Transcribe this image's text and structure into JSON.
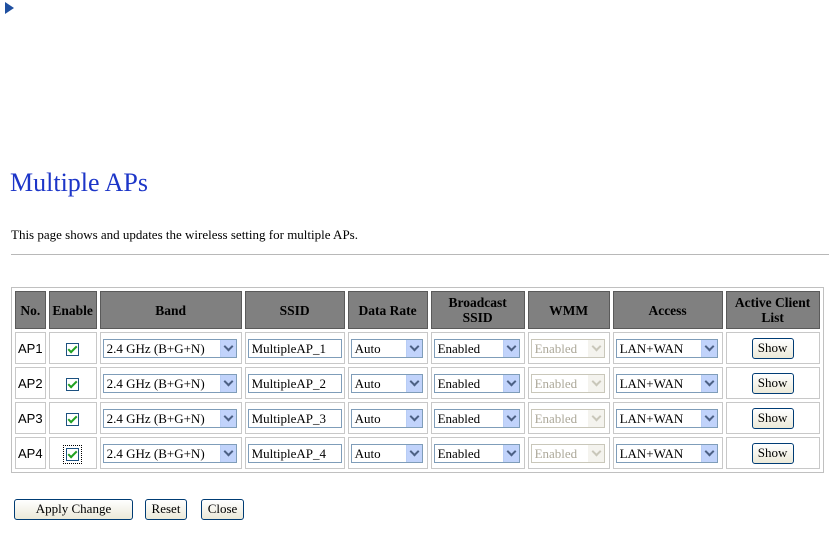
{
  "page": {
    "title": "Multiple APs",
    "description": "This page shows and updates the wireless setting for multiple APs."
  },
  "table": {
    "headers": {
      "no": "No.",
      "enable": "Enable",
      "band": "Band",
      "ssid": "SSID",
      "data_rate": "Data Rate",
      "broadcast_ssid_line1": "Broadcast",
      "broadcast_ssid_line2": "SSID",
      "wmm": "WMM",
      "access": "Access",
      "active_client_list_line1": "Active Client",
      "active_client_list_line2": "List"
    },
    "rows": [
      {
        "no": "AP1",
        "enabled": true,
        "band": "2.4 GHz (B+G+N)",
        "ssid": "MultipleAP_1",
        "data_rate": "Auto",
        "broadcast_ssid": "Enabled",
        "wmm": "Enabled",
        "access": "LAN+WAN",
        "show_label": "Show"
      },
      {
        "no": "AP2",
        "enabled": true,
        "band": "2.4 GHz (B+G+N)",
        "ssid": "MultipleAP_2",
        "data_rate": "Auto",
        "broadcast_ssid": "Enabled",
        "wmm": "Enabled",
        "access": "LAN+WAN",
        "show_label": "Show"
      },
      {
        "no": "AP3",
        "enabled": true,
        "band": "2.4 GHz (B+G+N)",
        "ssid": "MultipleAP_3",
        "data_rate": "Auto",
        "broadcast_ssid": "Enabled",
        "wmm": "Enabled",
        "access": "LAN+WAN",
        "show_label": "Show"
      },
      {
        "no": "AP4",
        "enabled": true,
        "band": "2.4 GHz (B+G+N)",
        "ssid": "MultipleAP_4",
        "data_rate": "Auto",
        "broadcast_ssid": "Enabled",
        "wmm": "Enabled",
        "access": "LAN+WAN",
        "show_label": "Show"
      }
    ]
  },
  "buttons": {
    "apply": "Apply Change",
    "reset": "Reset",
    "close": "Close"
  },
  "colors": {
    "title": "#1d36c8",
    "header_bg": "#808080",
    "check": "#21a121",
    "arrow_icon": "#1f4fa0"
  }
}
